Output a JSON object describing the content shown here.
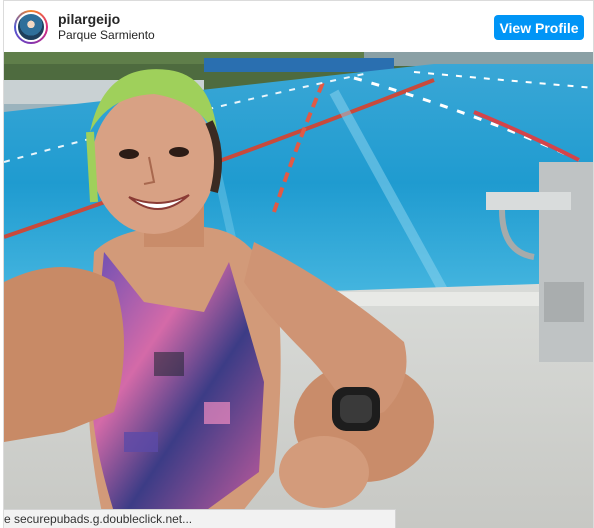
{
  "post": {
    "username": "pilargeijo",
    "location": "Parque Sarmiento",
    "view_profile_label": "View Profile",
    "photo_icon": "selfie-photo"
  },
  "status_bar": {
    "text": "e securepubads.g.doubleclick.net..."
  }
}
